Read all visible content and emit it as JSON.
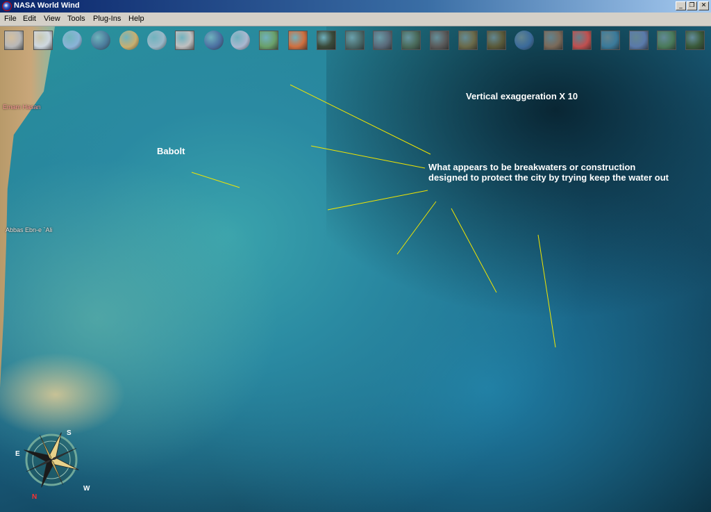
{
  "window": {
    "title": "NASA World Wind",
    "buttons": {
      "minimize": "_",
      "restore": "❐",
      "close": "✕"
    }
  },
  "menu": [
    "File",
    "Edit",
    "View",
    "Tools",
    "Plug-Ins",
    "Help"
  ],
  "toolbar": {
    "tools": [
      {
        "name": "layer-manager-icon",
        "color": "#b8b8b8"
      },
      {
        "name": "crosshair-icon",
        "color": "#cfd8e0"
      },
      {
        "name": "lat-lon-grid-icon",
        "color": "#8ab4d8"
      },
      {
        "name": "globe-icon",
        "color": "#4a7a9a"
      },
      {
        "name": "compass-tool-icon",
        "color": "#c8b070"
      },
      {
        "name": "clouds-icon",
        "color": "#9ab8c8"
      },
      {
        "name": "search-icon",
        "color": "#c0c0c0"
      },
      {
        "name": "blue-marble-icon",
        "color": "#4a6fa0"
      },
      {
        "name": "modis-icon",
        "color": "#aab8d0"
      },
      {
        "name": "wms-browser-icon",
        "color": "#6aa06a"
      },
      {
        "name": "scientific-visualization-icon",
        "color": "#d07040"
      },
      {
        "name": "landsat-visible-icon",
        "color": "#3a4a3a"
      },
      {
        "name": "landsat-pseudo-color-icon",
        "color": "#4a6a6a"
      },
      {
        "name": "landsat-false-color-icon",
        "color": "#5a6a7a"
      },
      {
        "name": "landsat-true-color-icon",
        "color": "#4a6a5a"
      },
      {
        "name": "usgs-topo-icon",
        "color": "#5a5a5a"
      },
      {
        "name": "usgs-urban-icon",
        "color": "#6a6a4a"
      },
      {
        "name": "usgs-ortho-icon",
        "color": "#5a5a3a"
      },
      {
        "name": "geocover-globe-icon",
        "color": "#3a6a9a"
      },
      {
        "name": "nltm-icon",
        "color": "#7a6a5a"
      },
      {
        "name": "flags-icon",
        "color": "#c05050"
      },
      {
        "name": "landmarks-icon",
        "color": "#3a7a9a"
      },
      {
        "name": "place-names-icon",
        "color": "#5a7aaa"
      },
      {
        "name": "boundaries-icon",
        "color": "#4a7a5a"
      },
      {
        "name": "plugin-settings-icon",
        "color": "#3a5a3a"
      }
    ]
  },
  "places": {
    "emam_hasan": "Emam Hasan",
    "abbas": "Abbas Ebn-e `Ali"
  },
  "annotations": {
    "babolt": "Babolt",
    "vertical": "Vertical exaggeration X 10",
    "breakwater_line1": "What appears to be breakwaters or construction",
    "breakwater_line2": "designed to protect the city by trying keep the water out"
  },
  "compass": {
    "labels": {
      "s": "S",
      "e": "E",
      "w": "W",
      "n": "N"
    }
  },
  "colors": {
    "annotation_line": "#f2e600",
    "title_bar": "#0a246a",
    "menu_bar": "#d4d0c8"
  }
}
